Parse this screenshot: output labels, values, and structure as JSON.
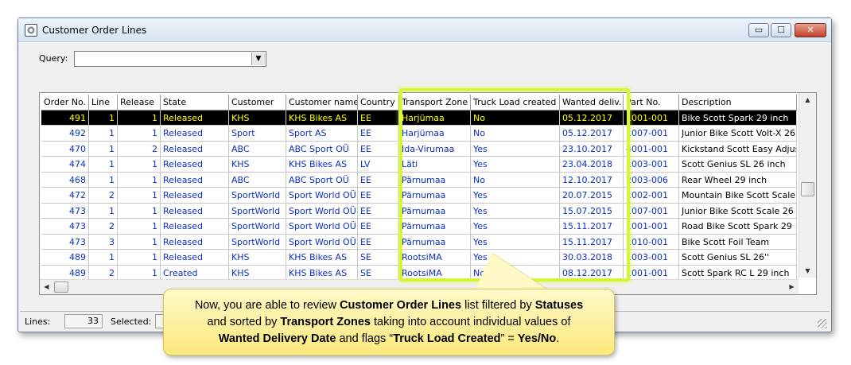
{
  "window": {
    "title": "Customer Order Lines",
    "min_icon": "minimize-icon",
    "max_icon": "maximize-icon",
    "close_icon": "close-icon",
    "min_glyph": "▭",
    "max_glyph": "☐",
    "close_glyph": "✕"
  },
  "query": {
    "label": "Query:",
    "value": "",
    "arrow": "▼"
  },
  "grid": {
    "columns": [
      "Order No.",
      "Line",
      "Release",
      "State",
      "Customer",
      "Customer name",
      "Country",
      "Transport Zone",
      "Truck Load created",
      "Wanted deliv.",
      "Part No.",
      "Description"
    ],
    "rows": [
      [
        "491",
        "1",
        "1",
        "Released",
        "KHS",
        "KHS Bikes AS",
        "EE",
        "Harjümaa",
        "No",
        "05.12.2017",
        "1001-001",
        "Bike Scott Spark 29 inch"
      ],
      [
        "492",
        "1",
        "1",
        "Released",
        "Sport",
        "Sport AS",
        "EE",
        "Harjümaa",
        "No",
        "05.12.2017",
        "1007-001",
        "Junior Bike Scott Volt-X 26"
      ],
      [
        "470",
        "1",
        "2",
        "Released",
        "ABC",
        "ABC Sport OÜ",
        "EE",
        "Ida-Virumaa",
        "Yes",
        "23.10.2017",
        "4001-001",
        "Kickstand Scott Easy Adjus"
      ],
      [
        "474",
        "1",
        "1",
        "Released",
        "KHS",
        "KHS Bikes AS",
        "LV",
        "Läti",
        "Yes",
        "23.04.2018",
        "1003-001",
        "Scott Genius SL 26 inch"
      ],
      [
        "468",
        "1",
        "1",
        "Released",
        "ABC",
        "ABC Sport OÜ",
        "EE",
        "Pärnumaa",
        "No",
        "12.10.2017",
        "2003-006",
        "Rear Wheel 29 inch"
      ],
      [
        "472",
        "2",
        "1",
        "Released",
        "SportWorld",
        "Sport World OÜ",
        "EE",
        "Pärnumaa",
        "Yes",
        "20.07.2015",
        "1002-001",
        "Mountain Bike Scott Scale"
      ],
      [
        "473",
        "1",
        "1",
        "Released",
        "SportWorld",
        "Sport World OÜ",
        "EE",
        "Pärnumaa",
        "Yes",
        "15.07.2015",
        "1007-001",
        "Junior Bike Scott Scale 26"
      ],
      [
        "473",
        "2",
        "1",
        "Released",
        "SportWorld",
        "Sport World OÜ",
        "EE",
        "Pärnumaa",
        "Yes",
        "15.11.2017",
        "1001-001",
        "Road Bike Scott Spark 29"
      ],
      [
        "473",
        "3",
        "1",
        "Released",
        "SportWorld",
        "Sport World OÜ",
        "EE",
        "Pärnumaa",
        "Yes",
        "15.11.2017",
        "1010-001",
        "Bike Scott Foil Team"
      ],
      [
        "489",
        "1",
        "1",
        "Released",
        "KHS",
        "KHS Bikes AS",
        "SE",
        "RootsiMA",
        "Yes",
        "30.03.2018",
        "1003-001",
        "Scott Genius SL 26''"
      ],
      [
        "489",
        "2",
        "1",
        "Created",
        "KHS",
        "KHS Bikes AS",
        "SE",
        "RootsiMA",
        "No",
        "08.12.2017",
        "1001-001",
        "Scott Spark RC L 29 inch"
      ]
    ],
    "scroll_up": "▲",
    "scroll_down": "▼",
    "scroll_left": "◀",
    "scroll_right": "▶"
  },
  "status": {
    "lines_label": "Lines:",
    "lines_value": "33",
    "selected_label": "Selected:"
  },
  "callout": {
    "t1": "Now, you are able to review ",
    "b1": "Customer Order Lines",
    "t2": " list filtered by ",
    "b2": "Statuses",
    "t3": " and sorted by ",
    "b3": "Transport Zones",
    "t4": " taking into account individual values of ",
    "b4": "Wanted Delivery Date",
    "t5": " and flags “",
    "b5": "Truck Load Created",
    "t6": "” = ",
    "b6": "Yes/No",
    "t7": "."
  },
  "colors": {
    "highlight": "#d6f63a",
    "row_text": "#0b2fc9",
    "selected_bg": "#000000",
    "selected_text": "#ffff00",
    "callout_bg": "#fbe97c"
  }
}
